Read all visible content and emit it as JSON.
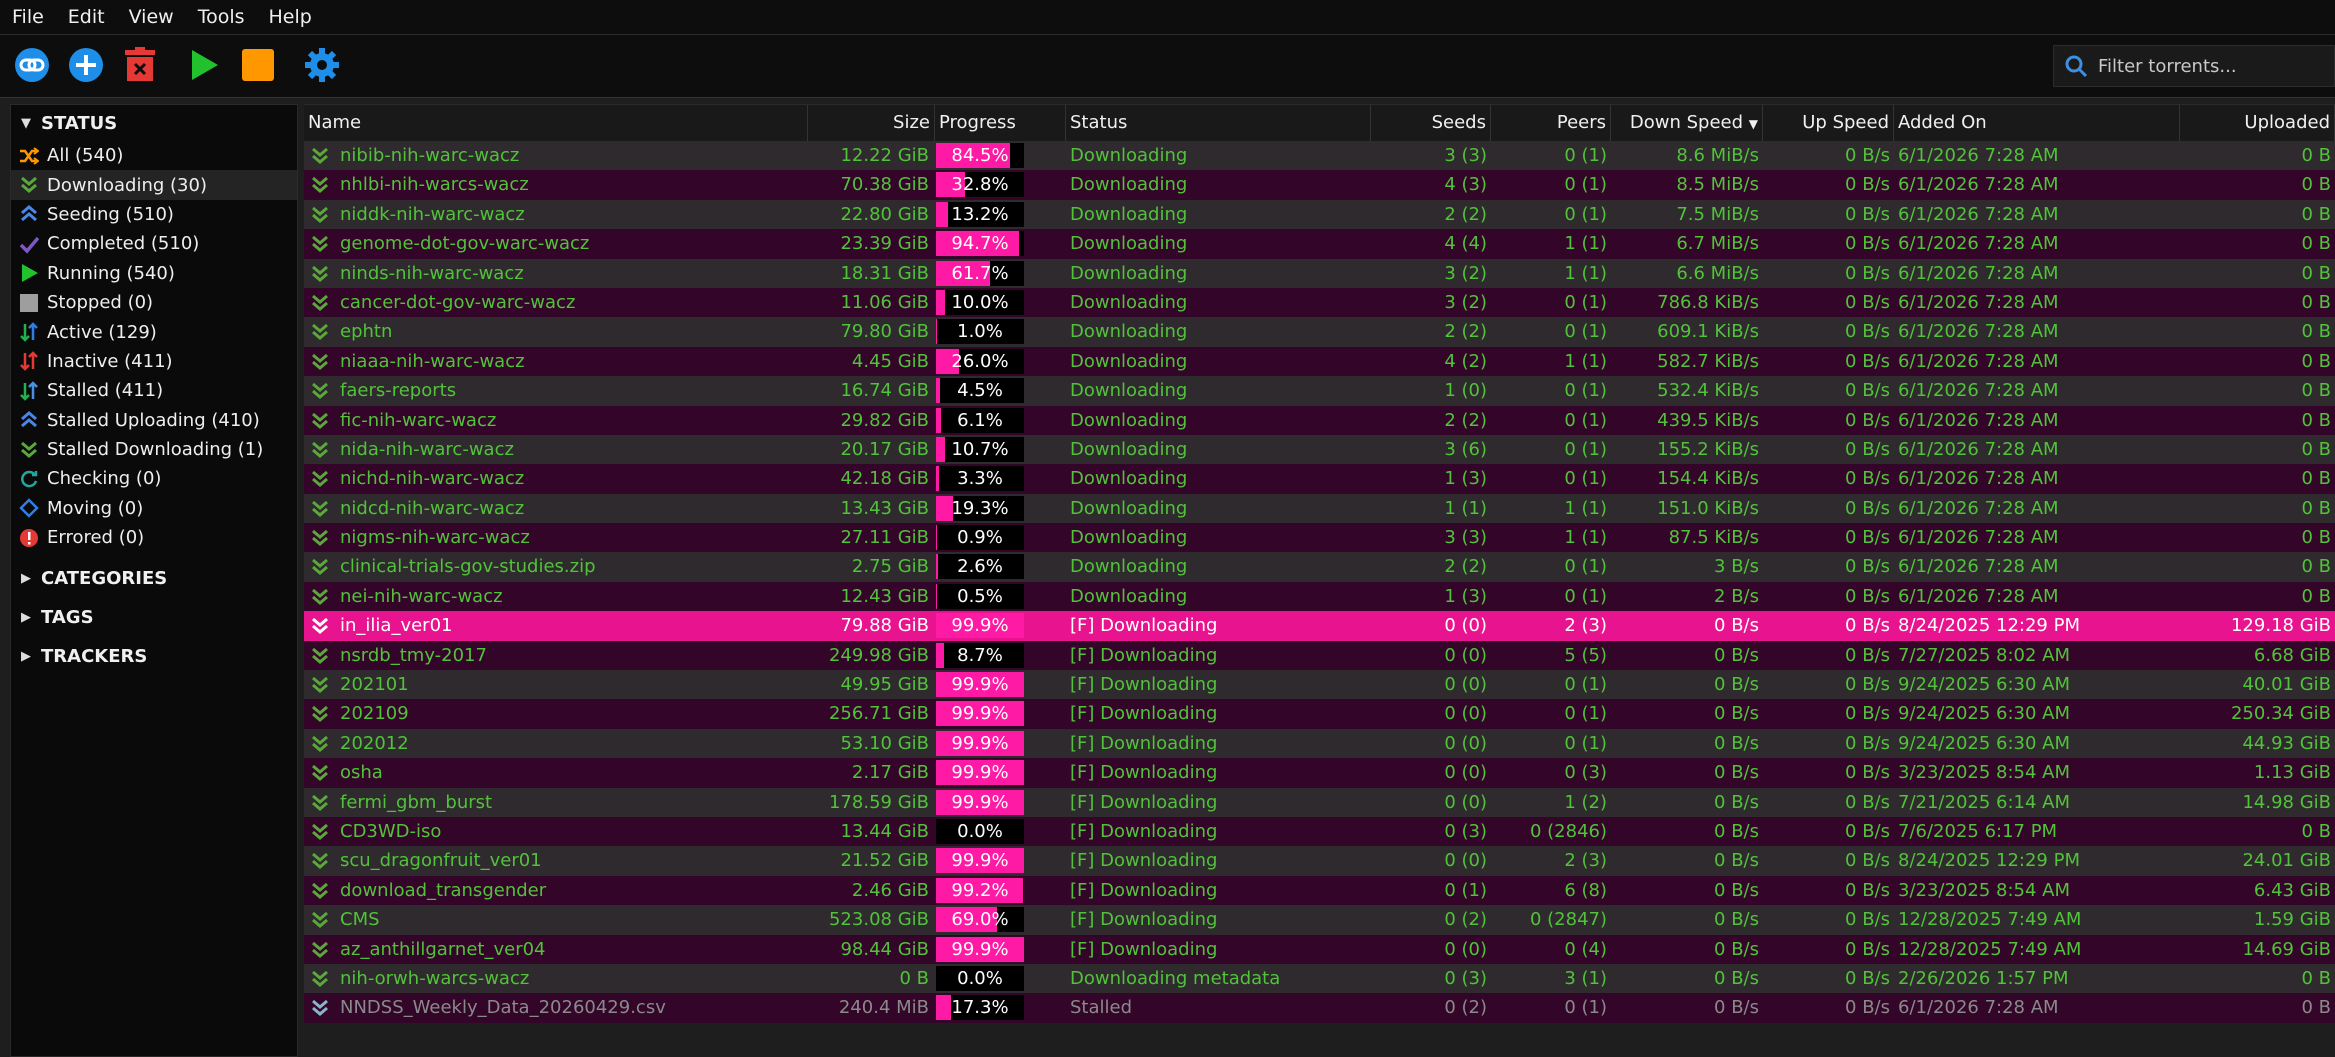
{
  "menu": [
    "File",
    "Edit",
    "View",
    "Tools",
    "Help"
  ],
  "toolbar": {
    "icons": [
      "link-icon",
      "add-icon",
      "delete-icon",
      "resume-icon",
      "pause-icon",
      "settings-icon"
    ],
    "filter_placeholder": "Filter torrents..."
  },
  "sidebar": {
    "status_header": "STATUS",
    "items": [
      {
        "label": "All (540)",
        "icon": "shuffle-icon"
      },
      {
        "label": "Downloading (30)",
        "icon": "downloading-icon"
      },
      {
        "label": "Seeding (510)",
        "icon": "seeding-icon"
      },
      {
        "label": "Completed (510)",
        "icon": "check-icon"
      },
      {
        "label": "Running (540)",
        "icon": "running-icon"
      },
      {
        "label": "Stopped (0)",
        "icon": "stopped-icon"
      },
      {
        "label": "Active (129)",
        "icon": "active-icon"
      },
      {
        "label": "Inactive (411)",
        "icon": "inactive-icon"
      },
      {
        "label": "Stalled (411)",
        "icon": "stalled-icon"
      },
      {
        "label": "Stalled Uploading (410)",
        "icon": "stalled-up-icon"
      },
      {
        "label": "Stalled Downloading (1)",
        "icon": "stalled-down-icon"
      },
      {
        "label": "Checking (0)",
        "icon": "checking-icon"
      },
      {
        "label": "Moving (0)",
        "icon": "moving-icon"
      },
      {
        "label": "Errored (0)",
        "icon": "error-icon"
      }
    ],
    "categories_header": "CATEGORIES",
    "tags_header": "TAGS",
    "trackers_header": "TRACKERS"
  },
  "columns": {
    "name": "Name",
    "size": "Size",
    "progress": "Progress",
    "status": "Status",
    "seeds": "Seeds",
    "peers": "Peers",
    "down_speed": "Down Speed",
    "up_speed": "Up Speed",
    "added_on": "Added On",
    "uploaded": "Uploaded"
  },
  "colors": {
    "accent": "#ff1aa6",
    "green": "#52c23a",
    "row_odd": "#2e2a2d",
    "row_even": "#330528"
  },
  "rows": [
    {
      "name": "nibib-nih-warc-wacz",
      "size": "12.22 GiB",
      "progress": "84.5%",
      "pct": 84.5,
      "status": "Downloading",
      "seeds": "3 (3)",
      "peers": "0 (1)",
      "down": "8.6 MiB/s",
      "up": "0 B/s",
      "added": "6/1/2026 7:28 AM",
      "uploaded": "0 B"
    },
    {
      "name": "nhlbi-nih-warcs-wacz",
      "size": "70.38 GiB",
      "progress": "32.8%",
      "pct": 32.8,
      "status": "Downloading",
      "seeds": "4 (3)",
      "peers": "0 (1)",
      "down": "8.5 MiB/s",
      "up": "0 B/s",
      "added": "6/1/2026 7:28 AM",
      "uploaded": "0 B"
    },
    {
      "name": "niddk-nih-warc-wacz",
      "size": "22.80 GiB",
      "progress": "13.2%",
      "pct": 13.2,
      "status": "Downloading",
      "seeds": "2 (2)",
      "peers": "0 (1)",
      "down": "7.5 MiB/s",
      "up": "0 B/s",
      "added": "6/1/2026 7:28 AM",
      "uploaded": "0 B"
    },
    {
      "name": "genome-dot-gov-warc-wacz",
      "size": "23.39 GiB",
      "progress": "94.7%",
      "pct": 94.7,
      "status": "Downloading",
      "seeds": "4 (4)",
      "peers": "1 (1)",
      "down": "6.7 MiB/s",
      "up": "0 B/s",
      "added": "6/1/2026 7:28 AM",
      "uploaded": "0 B"
    },
    {
      "name": "ninds-nih-warc-wacz",
      "size": "18.31 GiB",
      "progress": "61.7%",
      "pct": 61.7,
      "status": "Downloading",
      "seeds": "3 (2)",
      "peers": "1 (1)",
      "down": "6.6 MiB/s",
      "up": "0 B/s",
      "added": "6/1/2026 7:28 AM",
      "uploaded": "0 B"
    },
    {
      "name": "cancer-dot-gov-warc-wacz",
      "size": "11.06 GiB",
      "progress": "10.0%",
      "pct": 10.0,
      "status": "Downloading",
      "seeds": "3 (2)",
      "peers": "0 (1)",
      "down": "786.8 KiB/s",
      "up": "0 B/s",
      "added": "6/1/2026 7:28 AM",
      "uploaded": "0 B"
    },
    {
      "name": "ephtn",
      "size": "79.80 GiB",
      "progress": "1.0%",
      "pct": 1.0,
      "status": "Downloading",
      "seeds": "2 (2)",
      "peers": "0 (1)",
      "down": "609.1 KiB/s",
      "up": "0 B/s",
      "added": "6/1/2026 7:28 AM",
      "uploaded": "0 B"
    },
    {
      "name": "niaaa-nih-warc-wacz",
      "size": "4.45 GiB",
      "progress": "26.0%",
      "pct": 26.0,
      "status": "Downloading",
      "seeds": "4 (2)",
      "peers": "1 (1)",
      "down": "582.7 KiB/s",
      "up": "0 B/s",
      "added": "6/1/2026 7:28 AM",
      "uploaded": "0 B"
    },
    {
      "name": "faers-reports",
      "size": "16.74 GiB",
      "progress": "4.5%",
      "pct": 4.5,
      "status": "Downloading",
      "seeds": "1 (0)",
      "peers": "0 (1)",
      "down": "532.4 KiB/s",
      "up": "0 B/s",
      "added": "6/1/2026 7:28 AM",
      "uploaded": "0 B"
    },
    {
      "name": "fic-nih-warc-wacz",
      "size": "29.82 GiB",
      "progress": "6.1%",
      "pct": 6.1,
      "status": "Downloading",
      "seeds": "2 (2)",
      "peers": "0 (1)",
      "down": "439.5 KiB/s",
      "up": "0 B/s",
      "added": "6/1/2026 7:28 AM",
      "uploaded": "0 B"
    },
    {
      "name": "nida-nih-warc-wacz",
      "size": "20.17 GiB",
      "progress": "10.7%",
      "pct": 10.7,
      "status": "Downloading",
      "seeds": "3 (6)",
      "peers": "0 (1)",
      "down": "155.2 KiB/s",
      "up": "0 B/s",
      "added": "6/1/2026 7:28 AM",
      "uploaded": "0 B"
    },
    {
      "name": "nichd-nih-warc-wacz",
      "size": "42.18 GiB",
      "progress": "3.3%",
      "pct": 3.3,
      "status": "Downloading",
      "seeds": "1 (3)",
      "peers": "0 (1)",
      "down": "154.4 KiB/s",
      "up": "0 B/s",
      "added": "6/1/2026 7:28 AM",
      "uploaded": "0 B"
    },
    {
      "name": "nidcd-nih-warc-wacz",
      "size": "13.43 GiB",
      "progress": "19.3%",
      "pct": 19.3,
      "status": "Downloading",
      "seeds": "1 (1)",
      "peers": "1 (1)",
      "down": "151.0 KiB/s",
      "up": "0 B/s",
      "added": "6/1/2026 7:28 AM",
      "uploaded": "0 B"
    },
    {
      "name": "nigms-nih-warc-wacz",
      "size": "27.11 GiB",
      "progress": "0.9%",
      "pct": 0.9,
      "status": "Downloading",
      "seeds": "3 (3)",
      "peers": "1 (1)",
      "down": "87.5 KiB/s",
      "up": "0 B/s",
      "added": "6/1/2026 7:28 AM",
      "uploaded": "0 B"
    },
    {
      "name": "clinical-trials-gov-studies.zip",
      "size": "2.75 GiB",
      "progress": "2.6%",
      "pct": 2.6,
      "status": "Downloading",
      "seeds": "2 (2)",
      "peers": "0 (1)",
      "down": "3 B/s",
      "up": "0 B/s",
      "added": "6/1/2026 7:28 AM",
      "uploaded": "0 B"
    },
    {
      "name": "nei-nih-warc-wacz",
      "size": "12.43 GiB",
      "progress": "0.5%",
      "pct": 0.5,
      "status": "Downloading",
      "seeds": "1 (3)",
      "peers": "0 (1)",
      "down": "2 B/s",
      "up": "0 B/s",
      "added": "6/1/2026 7:28 AM",
      "uploaded": "0 B"
    },
    {
      "name": "in_ilia_ver01",
      "size": "79.88 GiB",
      "progress": "99.9%",
      "pct": 99.9,
      "status": "[F] Downloading",
      "seeds": "0 (0)",
      "peers": "2 (3)",
      "down": "0 B/s",
      "up": "0 B/s",
      "added": "8/24/2025 12:29 PM",
      "uploaded": "129.18 GiB",
      "selected": true
    },
    {
      "name": "nsrdb_tmy-2017",
      "size": "249.98 GiB",
      "progress": "8.7%",
      "pct": 8.7,
      "status": "[F] Downloading",
      "seeds": "0 (0)",
      "peers": "5 (5)",
      "down": "0 B/s",
      "up": "0 B/s",
      "added": "7/27/2025 8:02 AM",
      "uploaded": "6.68 GiB"
    },
    {
      "name": "202101",
      "size": "49.95 GiB",
      "progress": "99.9%",
      "pct": 99.9,
      "status": "[F] Downloading",
      "seeds": "0 (0)",
      "peers": "0 (1)",
      "down": "0 B/s",
      "up": "0 B/s",
      "added": "9/24/2025 6:30 AM",
      "uploaded": "40.01 GiB"
    },
    {
      "name": "202109",
      "size": "256.71 GiB",
      "progress": "99.9%",
      "pct": 99.9,
      "status": "[F] Downloading",
      "seeds": "0 (0)",
      "peers": "0 (1)",
      "down": "0 B/s",
      "up": "0 B/s",
      "added": "9/24/2025 6:30 AM",
      "uploaded": "250.34 GiB"
    },
    {
      "name": "202012",
      "size": "53.10 GiB",
      "progress": "99.9%",
      "pct": 99.9,
      "status": "[F] Downloading",
      "seeds": "0 (0)",
      "peers": "0 (1)",
      "down": "0 B/s",
      "up": "0 B/s",
      "added": "9/24/2025 6:30 AM",
      "uploaded": "44.93 GiB"
    },
    {
      "name": "osha",
      "size": "2.17 GiB",
      "progress": "99.9%",
      "pct": 99.9,
      "status": "[F] Downloading",
      "seeds": "0 (0)",
      "peers": "0 (3)",
      "down": "0 B/s",
      "up": "0 B/s",
      "added": "3/23/2025 8:54 AM",
      "uploaded": "1.13 GiB"
    },
    {
      "name": "fermi_gbm_burst",
      "size": "178.59 GiB",
      "progress": "99.9%",
      "pct": 99.9,
      "status": "[F] Downloading",
      "seeds": "0 (0)",
      "peers": "1 (2)",
      "down": "0 B/s",
      "up": "0 B/s",
      "added": "7/21/2025 6:14 AM",
      "uploaded": "14.98 GiB"
    },
    {
      "name": "CD3WD-iso",
      "size": "13.44 GiB",
      "progress": "0.0%",
      "pct": 0.0,
      "status": "[F] Downloading",
      "seeds": "0 (3)",
      "peers": "0 (2846)",
      "down": "0 B/s",
      "up": "0 B/s",
      "added": "7/6/2025 6:17 PM",
      "uploaded": "0 B"
    },
    {
      "name": "scu_dragonfruit_ver01",
      "size": "21.52 GiB",
      "progress": "99.9%",
      "pct": 99.9,
      "status": "[F] Downloading",
      "seeds": "0 (0)",
      "peers": "2 (3)",
      "down": "0 B/s",
      "up": "0 B/s",
      "added": "8/24/2025 12:29 PM",
      "uploaded": "24.01 GiB"
    },
    {
      "name": "download_transgender",
      "size": "2.46 GiB",
      "progress": "99.2%",
      "pct": 99.2,
      "status": "[F] Downloading",
      "seeds": "0 (1)",
      "peers": "6 (8)",
      "down": "0 B/s",
      "up": "0 B/s",
      "added": "3/23/2025 8:54 AM",
      "uploaded": "6.43 GiB"
    },
    {
      "name": "CMS",
      "size": "523.08 GiB",
      "progress": "69.0%",
      "pct": 69.0,
      "status": "[F] Downloading",
      "seeds": "0 (2)",
      "peers": "0 (2847)",
      "down": "0 B/s",
      "up": "0 B/s",
      "added": "12/28/2025 7:49 AM",
      "uploaded": "1.59 GiB"
    },
    {
      "name": "az_anthillgarnet_ver04",
      "size": "98.44 GiB",
      "progress": "99.9%",
      "pct": 99.9,
      "status": "[F] Downloading",
      "seeds": "0 (0)",
      "peers": "0 (4)",
      "down": "0 B/s",
      "up": "0 B/s",
      "added": "12/28/2025 7:49 AM",
      "uploaded": "14.69 GiB"
    },
    {
      "name": "nih-orwh-warcs-wacz",
      "size": "0 B",
      "progress": "0.0%",
      "pct": 0.0,
      "status": "Downloading metadata",
      "seeds": "0 (3)",
      "peers": "3 (1)",
      "down": "0 B/s",
      "up": "0 B/s",
      "added": "2/26/2026 1:57 PM",
      "uploaded": "0 B"
    },
    {
      "name": "NNDSS_Weekly_Data_20260429.csv",
      "size": "240.4 MiB",
      "progress": "17.3%",
      "pct": 17.3,
      "status": "Stalled",
      "seeds": "0 (2)",
      "peers": "0 (1)",
      "down": "0 B/s",
      "up": "0 B/s",
      "added": "6/1/2026 7:28 AM",
      "uploaded": "0 B",
      "stalled": true
    }
  ]
}
